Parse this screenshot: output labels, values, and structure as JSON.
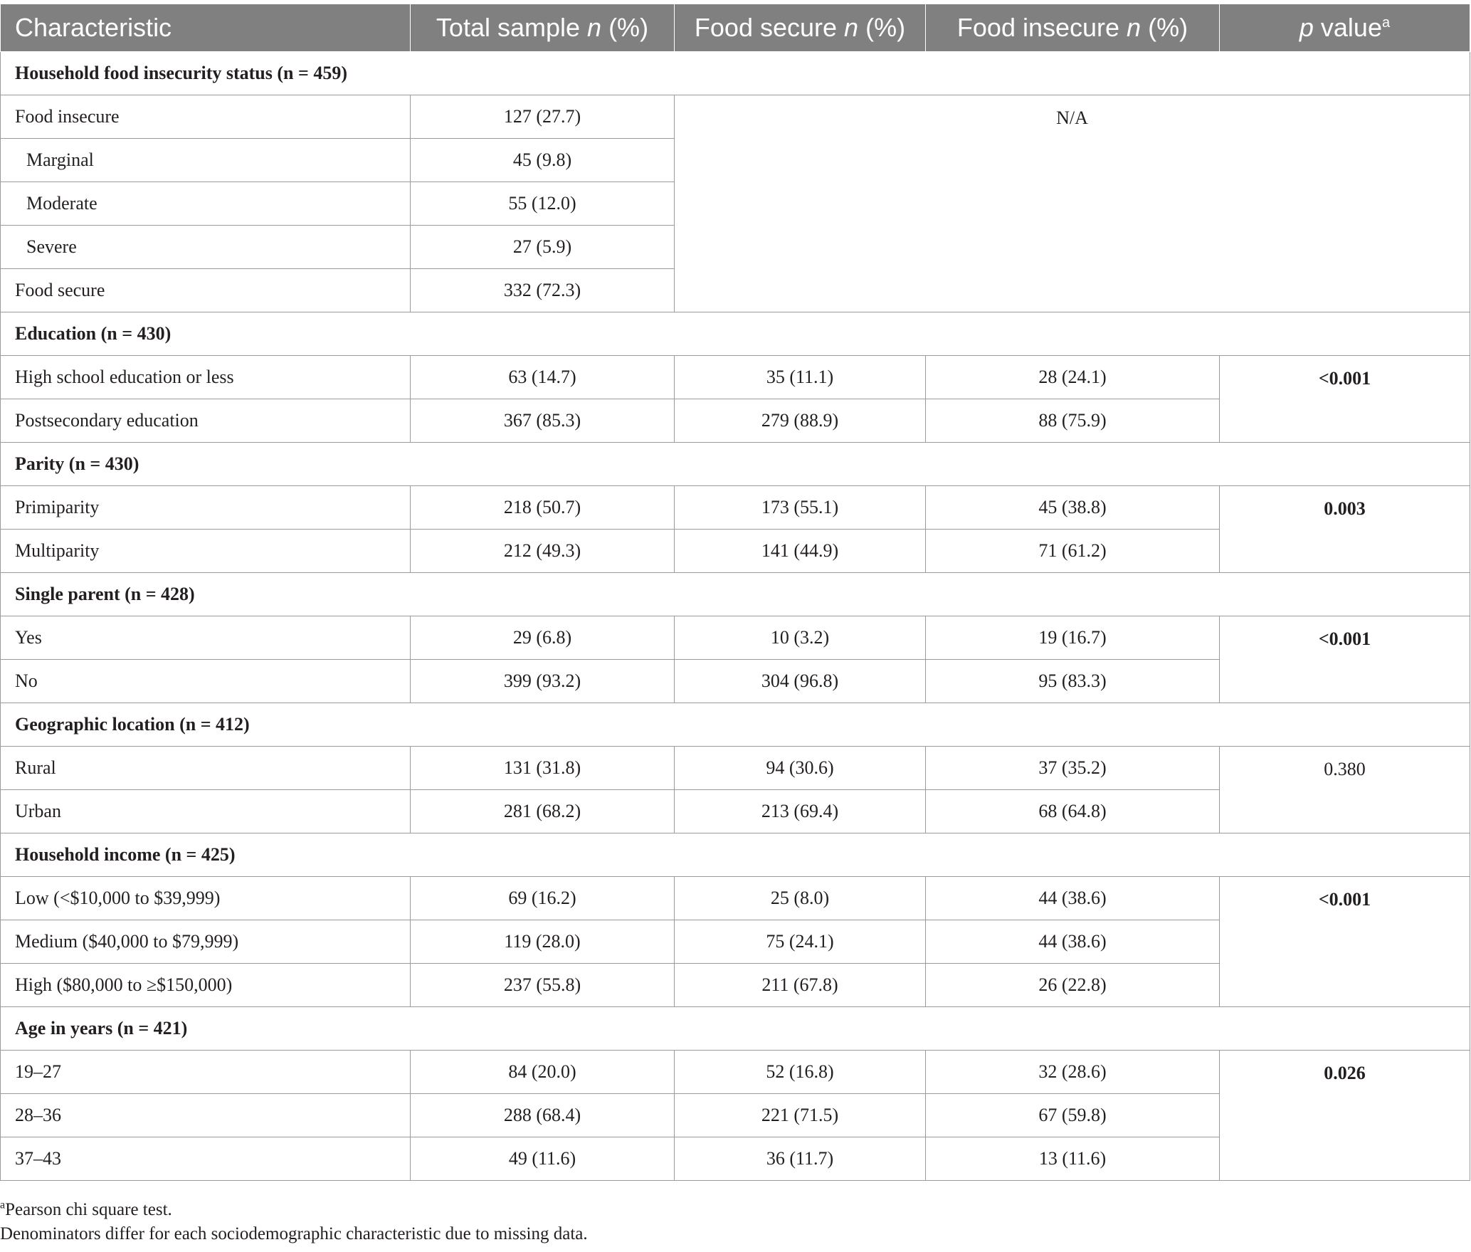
{
  "header": {
    "characteristic": "Characteristic",
    "total_pre": "Total sample ",
    "fs_pre": "Food secure ",
    "fi_pre": "Food insecure ",
    "n": "n",
    "pct": " (%)",
    "p": "p",
    "value": " value",
    "sup": "a"
  },
  "s_hh": {
    "title": "Household food insecurity status (n = 459)",
    "na": "N/A",
    "r1": {
      "label": "Food insecure",
      "total": "127 (27.7)"
    },
    "r2": {
      "label": "Marginal",
      "total": "45 (9.8)"
    },
    "r3": {
      "label": "Moderate",
      "total": "55 (12.0)"
    },
    "r4": {
      "label": "Severe",
      "total": "27 (5.9)"
    },
    "r5": {
      "label": "Food secure",
      "total": "332 (72.3)"
    }
  },
  "s_edu": {
    "title": "Education (n = 430)",
    "p": "<0.001",
    "r1": {
      "label": "High school education or less",
      "total": "63 (14.7)",
      "fs": "35 (11.1)",
      "fi": "28 (24.1)"
    },
    "r2": {
      "label": "Postsecondary education",
      "total": "367 (85.3)",
      "fs": "279 (88.9)",
      "fi": "88 (75.9)"
    }
  },
  "s_par": {
    "title": "Parity (n = 430)",
    "p": "0.003",
    "r1": {
      "label": "Primiparity",
      "total": "218 (50.7)",
      "fs": "173 (55.1)",
      "fi": "45 (38.8)"
    },
    "r2": {
      "label": "Multiparity",
      "total": "212 (49.3)",
      "fs": "141 (44.9)",
      "fi": "71 (61.2)"
    }
  },
  "s_sp": {
    "title": "Single parent (n = 428)",
    "p": "<0.001",
    "r1": {
      "label": "Yes",
      "total": "29 (6.8)",
      "fs": "10 (3.2)",
      "fi": "19 (16.7)"
    },
    "r2": {
      "label": "No",
      "total": "399 (93.2)",
      "fs": "304 (96.8)",
      "fi": "95 (83.3)"
    }
  },
  "s_geo": {
    "title": "Geographic location (n = 412)",
    "p": "0.380",
    "r1": {
      "label": "Rural",
      "total": "131 (31.8)",
      "fs": "94 (30.6)",
      "fi": "37 (35.2)"
    },
    "r2": {
      "label": "Urban",
      "total": "281 (68.2)",
      "fs": "213 (69.4)",
      "fi": "68 (64.8)"
    }
  },
  "s_inc": {
    "title": "Household income (n = 425)",
    "p": "<0.001",
    "r1": {
      "label": "Low (<$10,000 to $39,999)",
      "total": "69 (16.2)",
      "fs": "25 (8.0)",
      "fi": "44 (38.6)"
    },
    "r2": {
      "label": "Medium ($40,000 to $79,999)",
      "total": "119 (28.0)",
      "fs": "75 (24.1)",
      "fi": "44 (38.6)"
    },
    "r3": {
      "label": "High ($80,000 to ≥$150,000)",
      "total": "237 (55.8)",
      "fs": "211 (67.8)",
      "fi": "26 (22.8)"
    }
  },
  "s_age": {
    "title": "Age in years (n = 421)",
    "p": "0.026",
    "r1": {
      "label": "19–27",
      "total": "84 (20.0)",
      "fs": "52 (16.8)",
      "fi": "32 (28.6)"
    },
    "r2": {
      "label": "28–36",
      "total": "288 (68.4)",
      "fs": "221 (71.5)",
      "fi": "67 (59.8)"
    },
    "r3": {
      "label": "37–43",
      "total": "49 (11.6)",
      "fs": "36 (11.7)",
      "fi": "13 (11.6)"
    }
  },
  "footnotes": {
    "a_marker": "a",
    "a_text": "Pearson chi square test.",
    "b_text": "Denominators differ for each sociodemographic characteristic due to missing data."
  }
}
